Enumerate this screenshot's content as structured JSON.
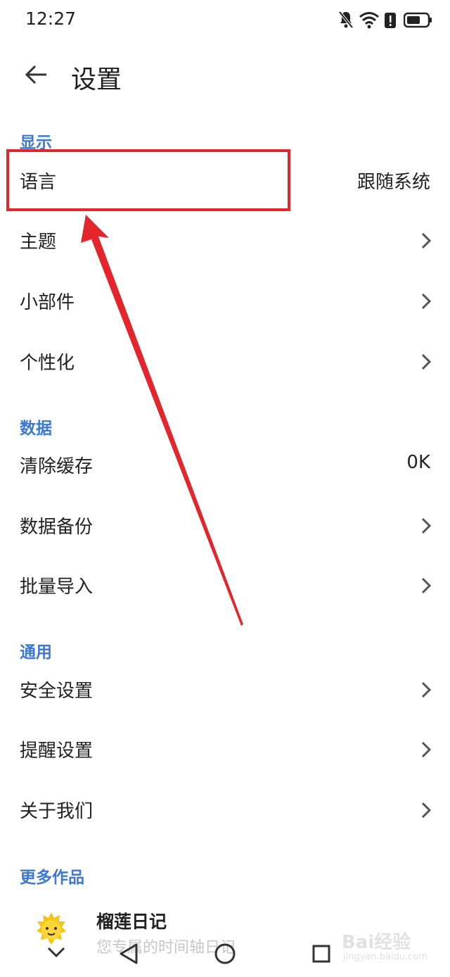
{
  "status_bar": {
    "time": "12:27",
    "icons": [
      "bell-off-icon",
      "wifi-icon",
      "alert-icon",
      "battery-icon"
    ]
  },
  "header": {
    "back_icon": "arrow-left-icon",
    "title": "设置"
  },
  "sections": [
    {
      "title": "显示",
      "items": [
        {
          "label": "语言",
          "value": "跟随系统"
        },
        {
          "label": "主题",
          "icon": "chevron-right-icon"
        },
        {
          "label": "小部件",
          "icon": "chevron-right-icon"
        },
        {
          "label": "个性化",
          "icon": "chevron-right-icon"
        }
      ]
    },
    {
      "title": "数据",
      "items": [
        {
          "label": "清除缓存",
          "value": "0K"
        },
        {
          "label": "数据备份",
          "icon": "chevron-right-icon"
        },
        {
          "label": "批量导入",
          "icon": "chevron-right-icon"
        }
      ]
    },
    {
      "title": "通用",
      "items": [
        {
          "label": "安全设置",
          "icon": "chevron-right-icon"
        },
        {
          "label": "提醒设置",
          "icon": "chevron-right-icon"
        },
        {
          "label": "关于我们",
          "icon": "chevron-right-icon"
        }
      ]
    },
    {
      "title": "更多作品",
      "items": []
    }
  ],
  "promo": {
    "icon": "durian-icon",
    "name": "榴莲日记",
    "description": "您专属的时间轴日记"
  },
  "nav_bar": {
    "icons": [
      "chevron-down-icon",
      "back-triangle-icon",
      "home-circle-icon",
      "recents-square-icon"
    ]
  },
  "watermark": {
    "text": "Bai经验",
    "sub": "jingyan.baidu.com"
  },
  "colors": {
    "accent": "#3a78d4",
    "annotation": "#e3262b"
  }
}
